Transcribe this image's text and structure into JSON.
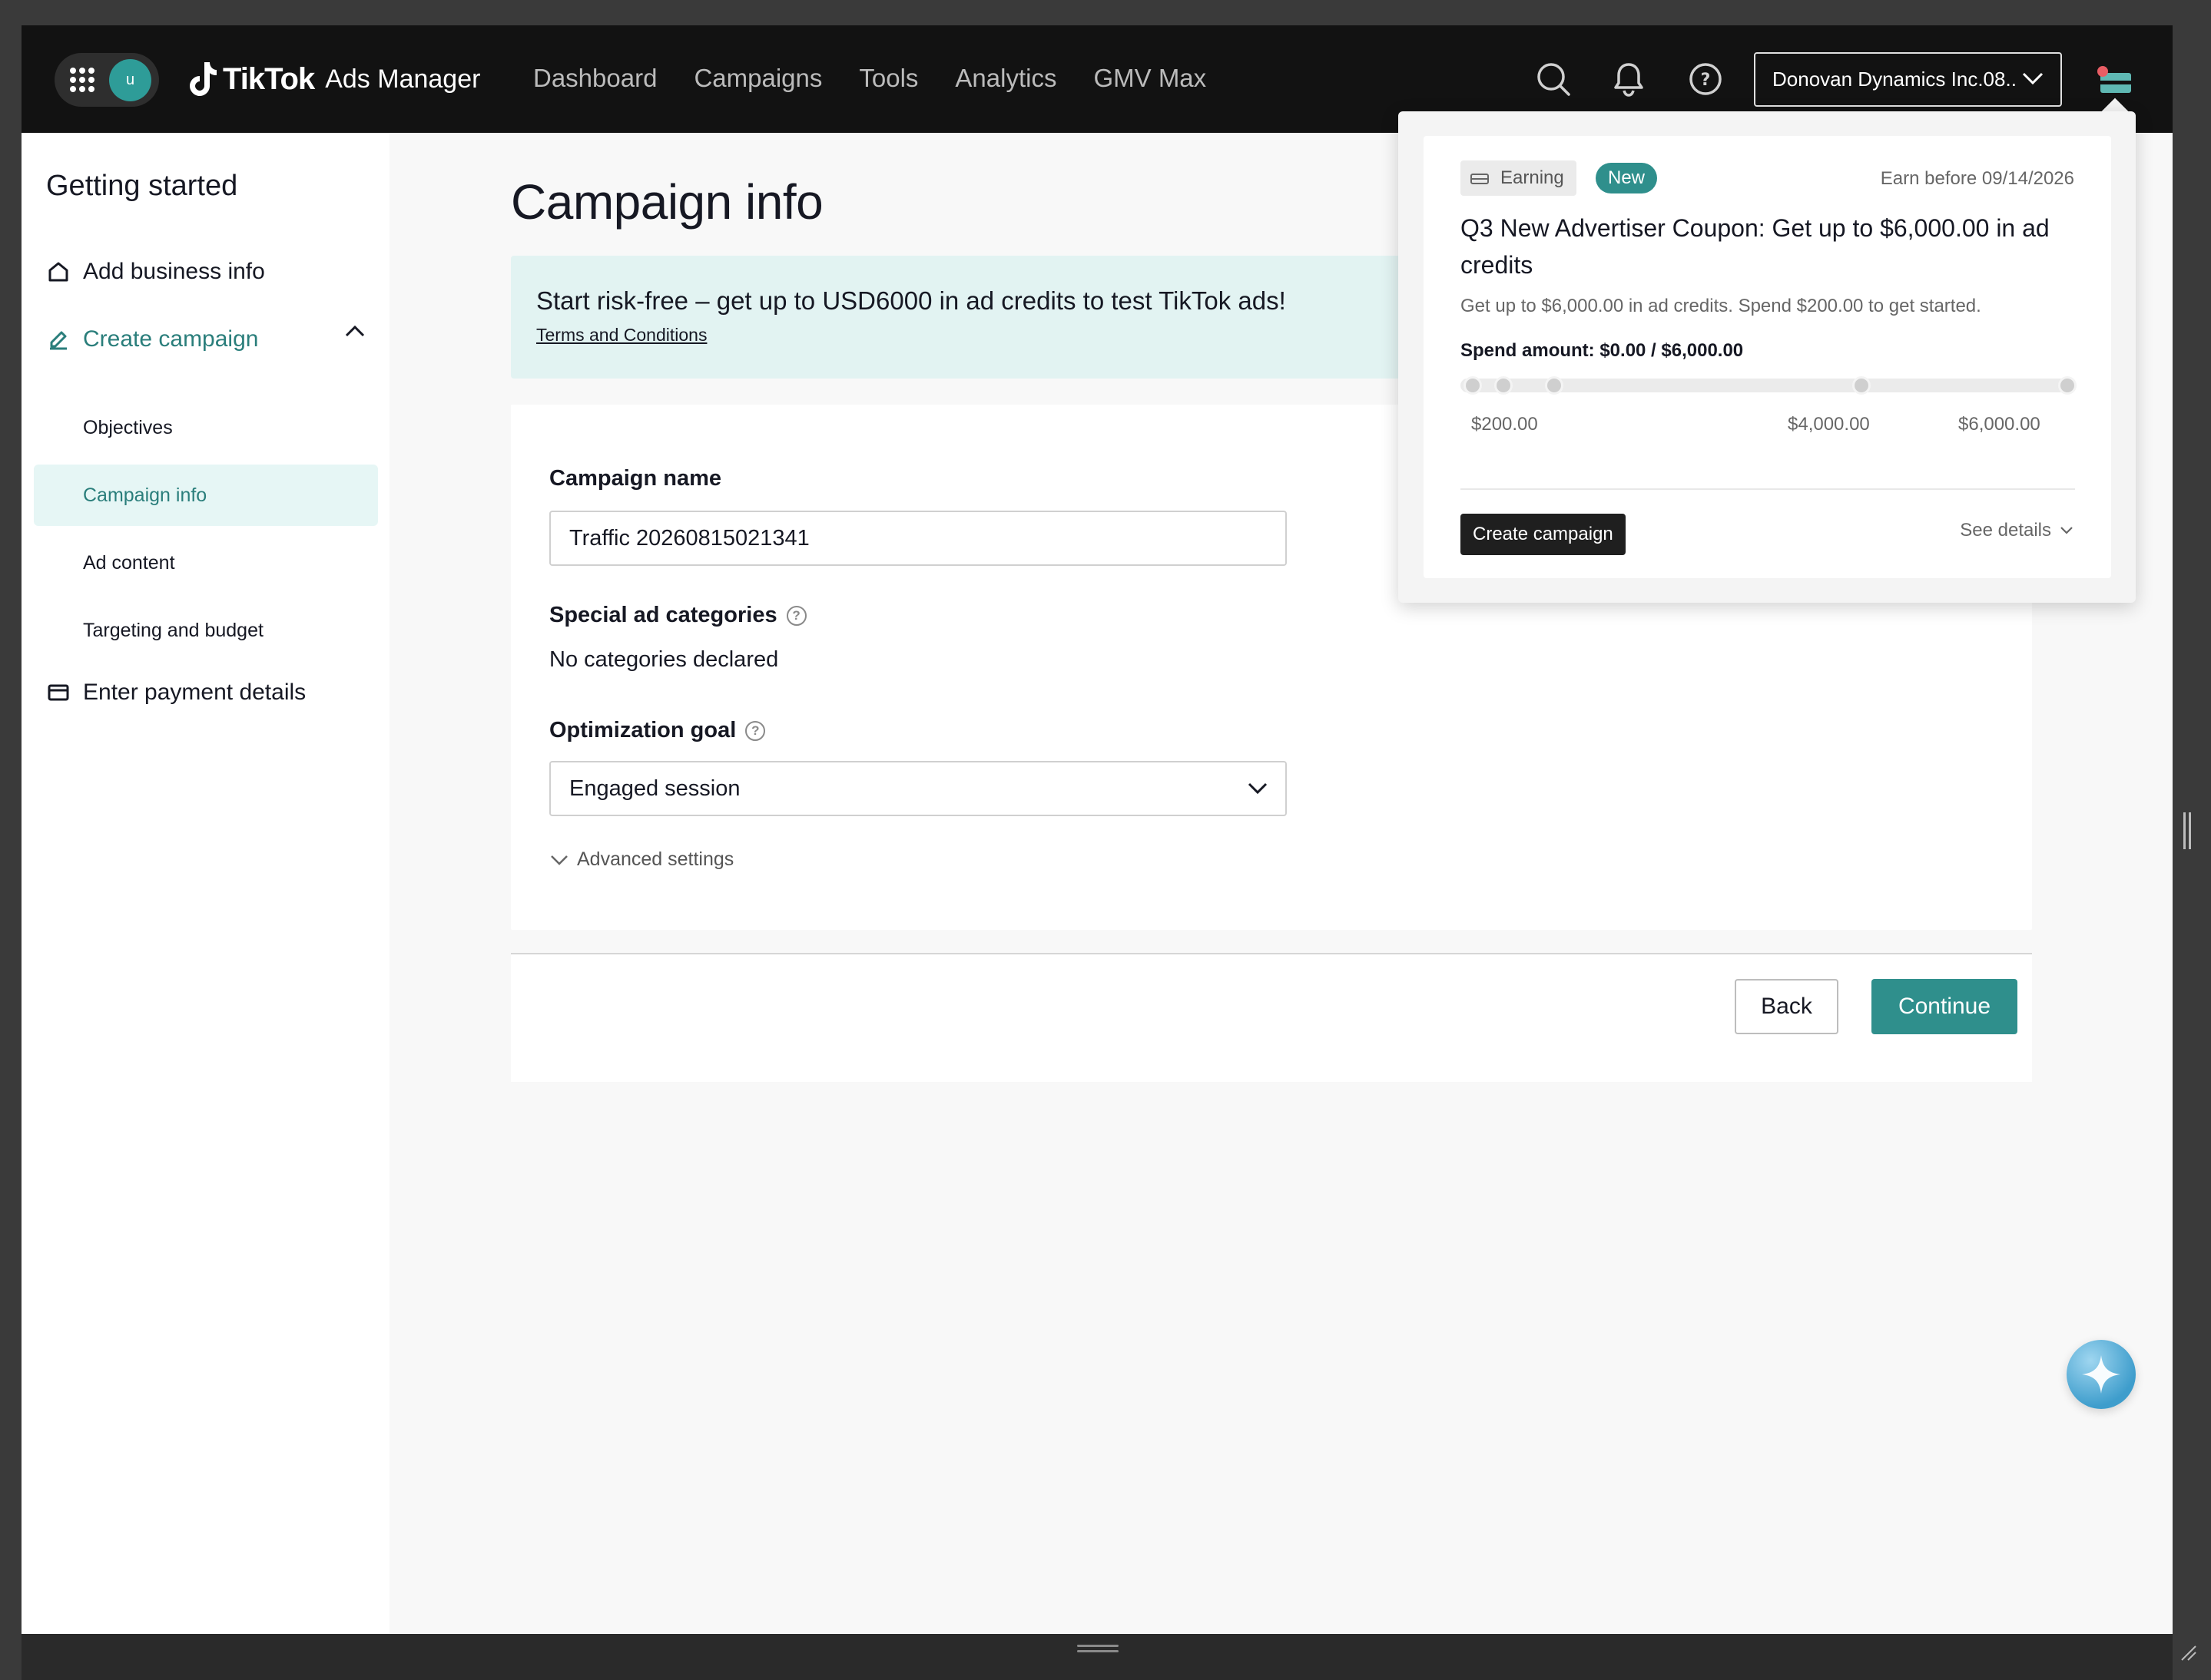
{
  "topnav": {
    "avatar_letter": "u",
    "brand_name": "TikTok",
    "brand_product": "Ads Manager",
    "links": [
      "Dashboard",
      "Campaigns",
      "Tools",
      "Analytics",
      "GMV Max"
    ],
    "account_name": "Donovan Dynamics Inc.08...",
    "icons": [
      "search-icon",
      "bell-icon",
      "help-icon",
      "coupon-icon"
    ]
  },
  "sidebar": {
    "title": "Getting started",
    "items": [
      {
        "label": "Add business info",
        "icon": "home-icon"
      },
      {
        "label": "Create campaign",
        "icon": "pencil-icon"
      },
      {
        "label": "Enter payment details",
        "icon": "card-icon"
      }
    ],
    "sub_items": [
      "Objectives",
      "Campaign info",
      "Ad content",
      "Targeting and budget"
    ],
    "active_sub_item": "Campaign info"
  },
  "main": {
    "title": "Campaign info",
    "banner": {
      "text": "Start risk-free – get up to USD6000 in ad credits to test TikTok ads!",
      "link": "Terms and Conditions"
    },
    "campaign_name_label": "Campaign name",
    "campaign_name_value": "Traffic 20260815021341",
    "special_categories_label": "Special ad categories",
    "special_categories_value": "No categories declared",
    "optimization_goal_label": "Optimization goal",
    "optimization_goal_value": "Engaged session",
    "advanced_settings": "Advanced settings",
    "back_button": "Back",
    "continue_button": "Continue"
  },
  "popover": {
    "tag_earning": "Earning",
    "tag_new": "New",
    "earn_before": "Earn before 09/14/2026",
    "title": "Q3 New Advertiser Coupon: Get up to $6,000.00 in ad credits",
    "description": "Get up to $6,000.00 in ad credits. Spend $200.00 to get started.",
    "spend_amount": "Spend amount: $0.00 / $6,000.00",
    "milestones": [
      "$200.00",
      "$4,000.00",
      "$6,000.00"
    ],
    "progress_fraction": 0,
    "create_button": "Create campaign",
    "see_details": "See details"
  },
  "colors": {
    "accent": "#2f8f8c",
    "nav_bg": "#121212",
    "banner_bg": "#e2f3f2"
  }
}
